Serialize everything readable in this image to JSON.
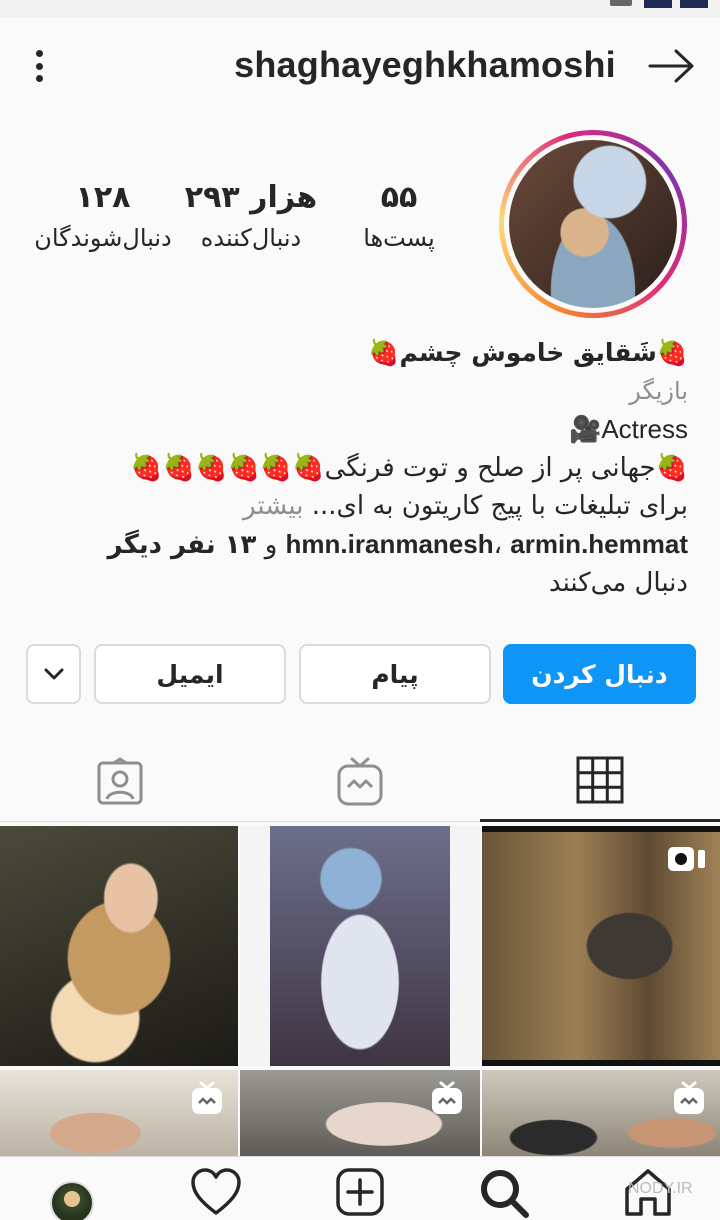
{
  "header": {
    "username": "shaghayeghkhamoshi"
  },
  "stats": {
    "posts": {
      "value": "۵۵",
      "label": "پست‌ها"
    },
    "followers": {
      "value": "۲۹۳ هزار",
      "label": "دنبال‌کننده"
    },
    "following": {
      "value": "۱۲۸",
      "label": "دنبال‌شوندگان"
    }
  },
  "bio": {
    "name_prefix_emoji": "🍓",
    "name": "شَقایق خاموش چشم",
    "name_suffix_emoji": "🍓",
    "category": "بازیگر",
    "line_actress": "Actress",
    "line_actress_emoji": "🎥",
    "line_strawberries_start": "🍓",
    "line_peace_text": "جهانی پر از صلح و توت فرنگی",
    "line_strawberries_end": "🍓🍓🍓🍓🍓🍓",
    "line_ads": "برای تبلیغات با پیج کاریتون به ای...",
    "more": "بیشتر",
    "followed_by_user1": "hmn.iranmanesh",
    "followed_by_sep": "،",
    "followed_by_user2": "armin.hemmat",
    "followed_by_and": "و",
    "followed_by_others": "۱۳ نفر دیگر",
    "followed_by_suffix": "دنبال می‌کنند"
  },
  "actions": {
    "follow": "دنبال کردن",
    "message": "پیام",
    "email": "ایمیل"
  },
  "tabs": {
    "active": "grid"
  },
  "watermark": "NODY.IR",
  "colors": {
    "follow_button": "#0f95f6",
    "text": "#262626",
    "secondary_text": "#8e8e8e",
    "background": "#fafafa"
  }
}
